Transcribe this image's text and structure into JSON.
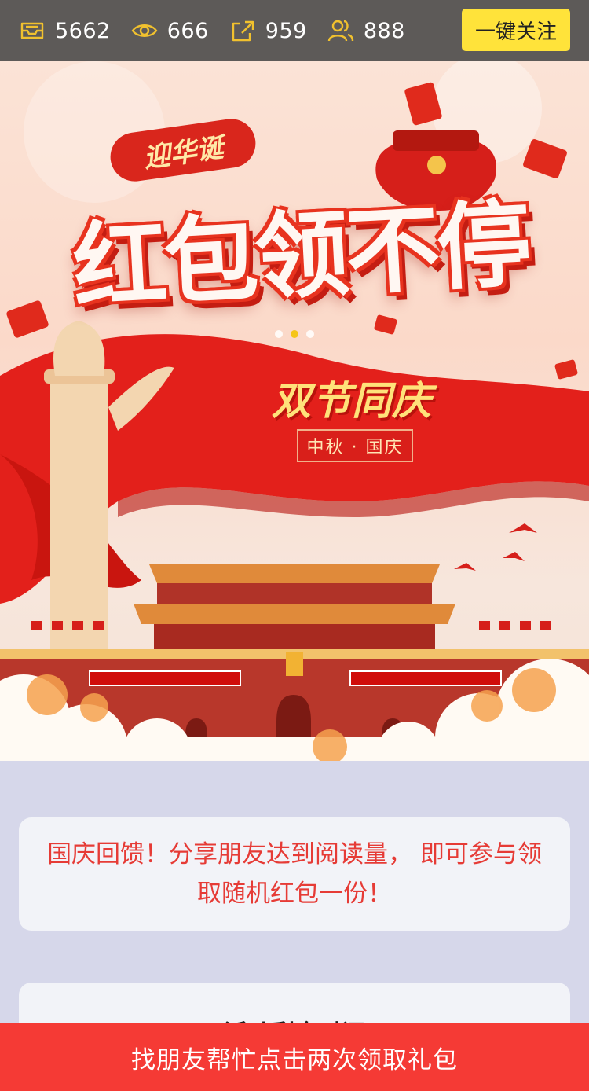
{
  "stats": {
    "articles": "5662",
    "views": "666",
    "shares": "959",
    "users": "888"
  },
  "follow_button": "一键关注",
  "banner": {
    "badge": "迎华诞",
    "title": "红包领不停",
    "subtitle": "双节同庆",
    "tag": "中秋 · 国庆",
    "carousel_index": 2,
    "carousel_count": 3
  },
  "notice": "国庆回馈！分享朋友达到阅读量， 即可参与领取随机红包一份！",
  "card2_title": "活动剩余时间",
  "bottom_button": "找朋友帮忙点击两次领取礼包",
  "colors": {
    "accent_red": "#f53a35",
    "follow_yellow": "#ffe33a",
    "topbar_gray": "#5d5a58",
    "icon_gold": "#f1c12e",
    "page_bg": "#d6d7ea"
  },
  "icons": [
    "inbox-icon",
    "eye-icon",
    "share-icon",
    "users-icon"
  ]
}
